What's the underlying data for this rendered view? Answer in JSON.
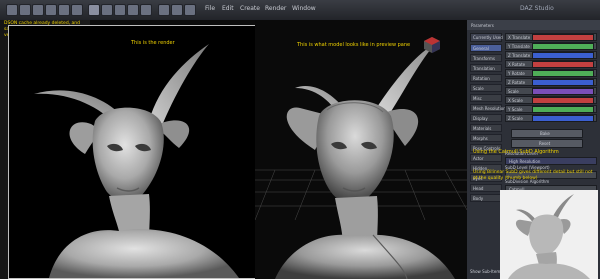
{
  "app": {
    "title": "DAZ Studio",
    "toolbar": {
      "icons": [
        "app-icon",
        "new-icon",
        "open-icon",
        "save-icon",
        "undo-icon",
        "redo-icon",
        "render-icon",
        "pointer-icon",
        "rotate-icon",
        "translate-icon",
        "scale-icon",
        "camera-icon",
        "light-icon",
        "figure-icon"
      ],
      "menus": [
        "File",
        "Edit",
        "Create",
        "Render",
        "Window"
      ]
    }
  },
  "render_window": {
    "caption": "This is the render",
    "note": "DSON cache already deleted, and same result in both my official DS version and the Beta Public Build"
  },
  "preview": {
    "caption": "This is what model looks like in preview pane"
  },
  "notes": {
    "catmull": "Using the Catmull SubD Algorithm",
    "bilinear": "Using Bilinear SubD gives different detail but still not at the quality (thumb below)"
  },
  "panel": {
    "header": "Parameters",
    "selection": "Currently Used",
    "groups": [
      "General",
      "Transforms",
      "Translation",
      "Rotation",
      "Scale",
      "Misc",
      "Mesh Resolution",
      "Display",
      "Materials",
      "Morphs",
      "Pose Controls",
      "Actor",
      "Hidden",
      "Eyes",
      "Head",
      "Body"
    ],
    "rows": [
      {
        "label": "X Translate"
      },
      {
        "label": "Y Translate"
      },
      {
        "label": "Z Translate"
      },
      {
        "label": "X Rotate"
      },
      {
        "label": "Y Rotate"
      },
      {
        "label": "Z Rotate"
      },
      {
        "label": "Scale"
      },
      {
        "label": "X Scale"
      },
      {
        "label": "Y Scale"
      },
      {
        "label": "Z Scale"
      }
    ],
    "buttons": [
      "Bake",
      "Reset"
    ],
    "subd": {
      "resolution_label": "Resolution Level",
      "resolution_value": "High Resolution",
      "subd_level_label": "SubD Level (Viewport)",
      "subd_algo_label": "SubDivision Algorithm",
      "subd_algo_value": "Catmull",
      "edge_label": "Edge Interpolation",
      "edge_value": "Edges Only"
    },
    "bottom_left": "Show Sub-Items"
  },
  "colors": {
    "caption": "#f0d200",
    "panel_bg": "#2d3038",
    "slider_green": "#4fae58",
    "slider_red": "#c24040",
    "slider_blue": "#3b5fd0",
    "slider_purple": "#7a4fb8",
    "slider_yellow": "#d3a93a"
  }
}
